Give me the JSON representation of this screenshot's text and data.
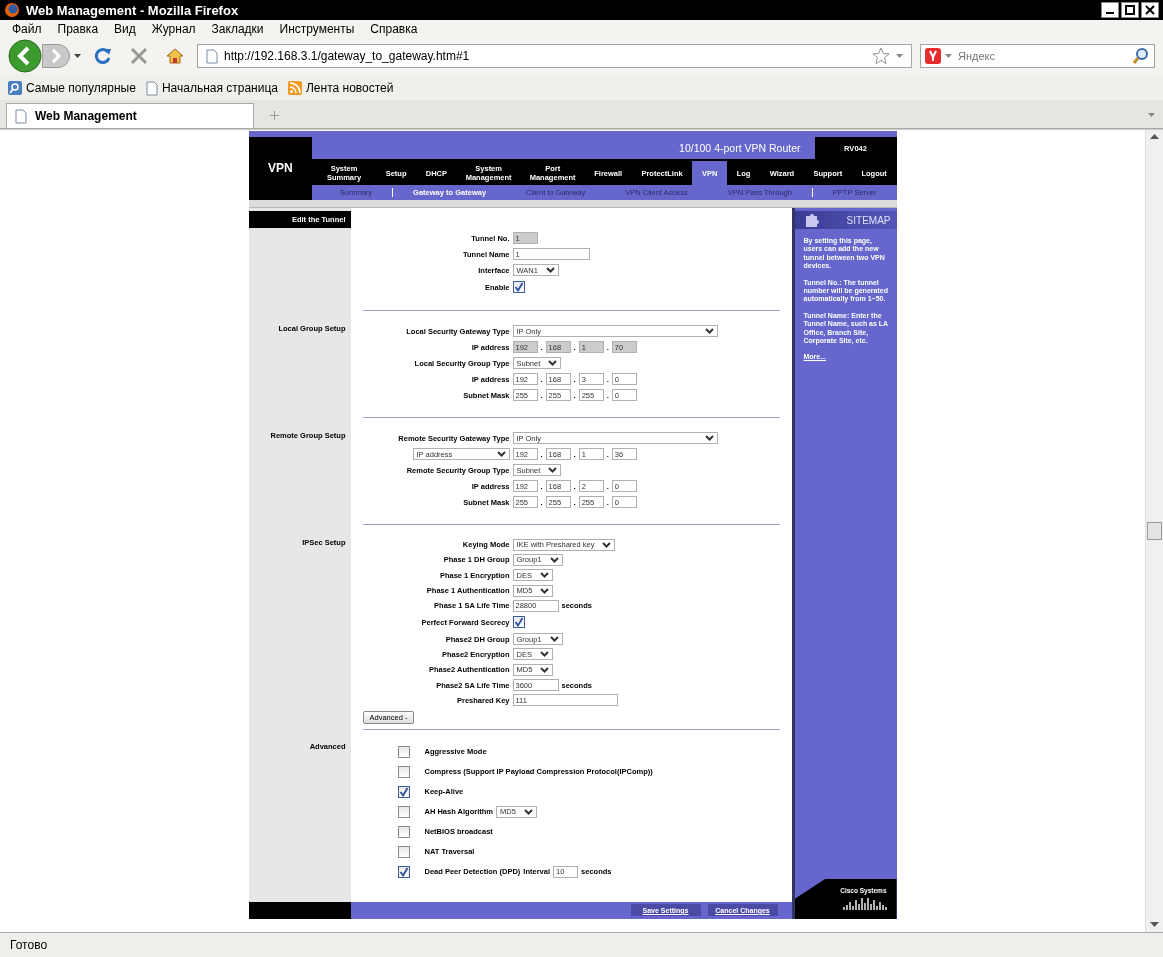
{
  "window": {
    "title": "Web Management - Mozilla Firefox"
  },
  "menu": [
    "Файл",
    "Правка",
    "Вид",
    "Журнал",
    "Закладки",
    "Инструменты",
    "Справка"
  ],
  "address_bar": {
    "url": "http://192.168.3.1/gateway_to_gateway.htm#1"
  },
  "search": {
    "placeholder": "Яндекс"
  },
  "bookmarks": [
    {
      "label": "Самые популярные",
      "kind": "search"
    },
    {
      "label": "Начальная страница",
      "kind": "page"
    },
    {
      "label": "Лента новостей",
      "kind": "feed"
    }
  ],
  "tabs": [
    {
      "label": "Web Management",
      "selected": true
    }
  ],
  "page": {
    "section": "VPN",
    "product": "10/100 4-port VPN Router",
    "model": "RV042",
    "nav": [
      {
        "label": "System Summary",
        "selected": false
      },
      {
        "label": "Setup",
        "selected": false
      },
      {
        "label": "DHCP",
        "selected": false
      },
      {
        "label": "System Management",
        "selected": false
      },
      {
        "label": "Port Management",
        "selected": false
      },
      {
        "label": "Firewall",
        "selected": false
      },
      {
        "label": "ProtectLink",
        "selected": false
      },
      {
        "label": "VPN",
        "selected": true
      },
      {
        "label": "Log",
        "selected": false
      },
      {
        "label": "Wizard",
        "selected": false
      },
      {
        "label": "Support",
        "selected": false
      },
      {
        "label": "Logout",
        "selected": false
      }
    ],
    "subnav": [
      {
        "label": "Summary",
        "selected": false,
        "divider": true
      },
      {
        "label": "Gateway to Gateway",
        "selected": true,
        "divider": false
      },
      {
        "label": "Client to Gateway",
        "selected": false,
        "divider": false
      },
      {
        "label": "VPN Client Access",
        "selected": false,
        "divider": false
      },
      {
        "label": "VPN Pass Through",
        "selected": false,
        "divider": true
      },
      {
        "label": "PPTP Server",
        "selected": false,
        "divider": false
      }
    ],
    "sections": [
      {
        "title": "Edit the Tunnel",
        "kind": "header",
        "rows": [
          {
            "label": "Tunnel No.",
            "controls": [
              {
                "kind": "short-input",
                "value": "1",
                "disabled": true
              }
            ]
          },
          {
            "label": "Tunnel Name",
            "controls": [
              {
                "kind": "input",
                "value": "1",
                "disabled": false
              }
            ]
          },
          {
            "label": "Interface",
            "controls": [
              {
                "kind": "select",
                "value": "WAN1"
              }
            ]
          },
          {
            "label": "Enable",
            "controls": [
              {
                "kind": "checkbox",
                "checked": true
              }
            ]
          }
        ]
      },
      {
        "title": "Local Group Setup",
        "kind": "form",
        "rows": [
          {
            "label": "Local Security Gateway Type",
            "controls": [
              {
                "kind": "wide-select",
                "value": "IP Only"
              }
            ]
          },
          {
            "label": "IP address",
            "controls": [
              {
                "kind": "ip",
                "octets": [
                  "192",
                  "168",
                  "1",
                  "70"
                ],
                "separator": ".",
                "disabled": true
              }
            ]
          },
          {
            "label": "Local Security Group Type",
            "controls": [
              {
                "kind": "select",
                "value": "Subnet"
              }
            ]
          },
          {
            "label": "IP address",
            "controls": [
              {
                "kind": "ip",
                "octets": [
                  "192",
                  "168",
                  "3",
                  "0"
                ],
                "separator": ".",
                "disabled": false
              }
            ]
          },
          {
            "label": "Subnet Mask",
            "controls": [
              {
                "kind": "ip",
                "octets": [
                  "255",
                  "255",
                  "255",
                  "0"
                ],
                "separator": ".",
                "disabled": false
              }
            ]
          }
        ]
      },
      {
        "title": "Remote Group Setup",
        "kind": "form",
        "rows": [
          {
            "label": "Remote Security Gateway Type",
            "controls": [
              {
                "kind": "wide-select",
                "value": "IP Only"
              }
            ]
          },
          {
            "label_select": "IP address",
            "controls": [
              {
                "kind": "ip",
                "octets": [
                  "192",
                  "168",
                  "1",
                  "36"
                ],
                "separator": ".",
                "disabled": false
              }
            ]
          },
          {
            "label": "Remote Security Group Type",
            "controls": [
              {
                "kind": "select",
                "value": "Subnet"
              }
            ]
          },
          {
            "label": "IP address",
            "controls": [
              {
                "kind": "ip",
                "octets": [
                  "192",
                  "168",
                  "2",
                  "0"
                ],
                "separator": ".",
                "disabled": false
              }
            ]
          },
          {
            "label": "Subnet Mask",
            "controls": [
              {
                "kind": "ip",
                "octets": [
                  "255",
                  "255",
                  "255",
                  "0"
                ],
                "separator": ".",
                "disabled": false
              }
            ]
          }
        ]
      },
      {
        "title": "IPSec Setup",
        "kind": "form",
        "button": "Advanced -",
        "rows": [
          {
            "label": "Keying Mode",
            "controls": [
              {
                "kind": "select",
                "value": "IKE with Preshared key"
              }
            ]
          },
          {
            "label": "Phase 1 DH Group",
            "controls": [
              {
                "kind": "select",
                "value": "Group1"
              }
            ]
          },
          {
            "label": "Phase 1 Encryption",
            "controls": [
              {
                "kind": "select",
                "value": "DES"
              }
            ]
          },
          {
            "label": "Phase 1 Authentication",
            "controls": [
              {
                "kind": "select",
                "value": "MD5"
              }
            ]
          },
          {
            "label": "Phase 1 SA Life Time",
            "controls": [
              {
                "kind": "input",
                "value": "28800",
                "disabled": false
              },
              {
                "kind": "text",
                "text": "seconds"
              }
            ]
          },
          {
            "label": "Perfect Forward Secrecy",
            "controls": [
              {
                "kind": "checkbox",
                "checked": true
              }
            ]
          },
          {
            "label": "Phase2 DH Group",
            "controls": [
              {
                "kind": "select",
                "value": "Group1"
              }
            ]
          },
          {
            "label": "Phase2 Encryption",
            "controls": [
              {
                "kind": "select",
                "value": "DES"
              }
            ]
          },
          {
            "label": "Phase2 Authentication",
            "controls": [
              {
                "kind": "select",
                "value": "MD5"
              }
            ]
          },
          {
            "label": "Phase2 SA Life Time",
            "controls": [
              {
                "kind": "input",
                "value": "3600",
                "disabled": false
              },
              {
                "kind": "text",
                "text": "seconds"
              }
            ]
          },
          {
            "label": "Preshared Key",
            "controls": [
              {
                "kind": "long-input",
                "value": "111",
                "disabled": false
              }
            ]
          }
        ]
      },
      {
        "title": "Advanced",
        "kind": "checklist",
        "rows": [
          {
            "label": "Aggressive Mode",
            "checked": false,
            "controls": []
          },
          {
            "label": "Compress (Support IP Payload Compression Protocol(IPComp))",
            "checked": false,
            "controls": []
          },
          {
            "label": "Keep-Alive",
            "checked": true,
            "controls": []
          },
          {
            "label": "AH Hash Algorithm",
            "checked": false,
            "controls": [
              {
                "kind": "select",
                "value": "MD5"
              }
            ]
          },
          {
            "label": "NetBIOS broadcast",
            "checked": false,
            "controls": []
          },
          {
            "label": "NAT Traversal",
            "checked": false,
            "controls": []
          },
          {
            "label": "Dead Peer Detection (DPD)",
            "checked": true,
            "controls": [
              {
                "kind": "text",
                "text": "Interval"
              },
              {
                "kind": "short-input",
                "value": "10",
                "disabled": false
              },
              {
                "kind": "text",
                "text": "seconds"
              }
            ]
          }
        ]
      }
    ],
    "sitemap": {
      "title": "SITEMAP",
      "paragraphs": [
        "By setting this page, users can add the new tunnel between two VPN devices.",
        "Tunnel No.: The tunnel number will be generated automatically from 1~50.",
        "Tunnel Name: Enter the Tunnel Name, such as LA Office, Branch Site, Corporate Site, etc."
      ],
      "link": "More..."
    },
    "buttons": [
      "Save Settings",
      "Cancel Changes"
    ],
    "brand": "Cisco Systems"
  },
  "status_bar": "Готово"
}
